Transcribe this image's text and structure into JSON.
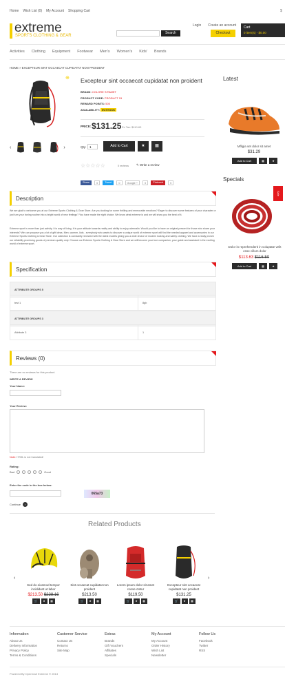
{
  "topnav": {
    "items": [
      "Home",
      "Wish List (0)",
      "My Account",
      "Shopping Cart"
    ],
    "currency": "$"
  },
  "logo": {
    "title": "extreme",
    "subtitle": "SPORTS CLOTHING & GEAR"
  },
  "search": {
    "placeholder": "",
    "button": "Search"
  },
  "account": {
    "login": "Login",
    "create": "Create an account",
    "checkout": "Checkout"
  },
  "cart": {
    "label": "Cart",
    "value": "0 item(s) - $0.00"
  },
  "categories": [
    "Activities",
    "Clothing",
    "Equipment",
    "Footwear",
    "Men's",
    "Women's",
    "Kids'",
    "Brands"
  ],
  "breadcrumb": "HOME » EXCEPTEUR SINT OCCAECAT CUPIDATAT NON PROIDENT",
  "product": {
    "title": "Excepteur sint occaecat cupidatat non proident",
    "brand_label": "BRAND:",
    "brand": "COLORE SITAMET",
    "code_label": "PRODUCT CODE:",
    "code": "PRODUCT 15",
    "points_label": "REWARD POINTS:",
    "points": "500",
    "avail_label": "AVAILABILITY:",
    "avail": "IN STOCK",
    "price_label": "PRICE:",
    "price": "$131.25",
    "extax": "Ex Tax: $110.63",
    "qty_label": "Qty:",
    "qty": "1",
    "add": "Add to Cart",
    "reviews": "0 reviews",
    "write": "Write a review"
  },
  "social": {
    "share": "Share",
    "share_n": "0",
    "tweet": "Tweet",
    "tweet_n": "0",
    "google": "Google +",
    "google_n": "0",
    "pin": "Pinterest",
    "pin_n": "0"
  },
  "description": {
    "title": "Description",
    "p1": "We are glad to welcome you at our Extreme Sports Clothing & Gear Store. Are you looking for some thrilling and memorable emotions? Eager to discover some features of your character or just turn your boring routine into a bright world of new feelings? You have made the right choice. We know what extreme is and we will show you the best of it.",
    "p2": "Extreme sport is more than just activity. It is way of living. It is your attitude towards reality and ability to enjoy adrenalin. Would you like to have an original present for those who share your interests? We can propose you a lot of gift ideas. Men, women, kids - everybody who wants to discover a unique world of extreme sport will find the needed apparel and accessories in our Extreme Sports Clothing & Gear Store. Our collection is constantly renewed with the latest models giving you a wide choice of modern looking and safety clothing. We have a really proven our reliability promising goods of premium quality only. Choose our Extreme Sports Clothing & Gear Store and we will become your true companion, your guide and assistant in the exciting world of extreme sport."
  },
  "spec": {
    "title": "Specification",
    "rows": [
      [
        "ATTRIBUTE GROUPS 5",
        ""
      ],
      [
        "test 1",
        "8gb"
      ],
      [
        "ATTRIBUTE GROUPS 3",
        ""
      ],
      [
        "Attribute 3",
        "1"
      ]
    ]
  },
  "reviews": {
    "title": "Reviews (0)",
    "none": "There are no reviews for this product.",
    "write": "WRITE A REVIEW",
    "name": "Your Name:",
    "review": "Your Review:",
    "note_label": "Note:",
    "note": "HTML is not translated!",
    "rating": "Rating:",
    "bad": "Bad",
    "good": "Good",
    "captcha_label": "Enter the code in the box below:",
    "captcha": "065a73",
    "continue": "Continue"
  },
  "sidebar": {
    "latest": "Latest",
    "latest_name": "Mfligia set dolor sit amet",
    "latest_price": "$31.29",
    "add": "Add to Cart",
    "specials": "Specials",
    "sale": "Sale",
    "special_name": "Dolor in reprehenderit in voluptate velit esse cillum dolor",
    "special_new": "$113.63",
    "special_old": "$116.50"
  },
  "related": {
    "title": "Related Products",
    "items": [
      {
        "name": "Sed do eiusmod tempor incididunt ut labor",
        "new": "$213.50",
        "old": "$228.16",
        "sale": true
      },
      {
        "name": "Sint occaecat cupidatat non proident",
        "new": "$213.50",
        "old": "",
        "sale": false
      },
      {
        "name": "Lorem ipsum dolor sit amet conse ctetur",
        "new": "$119.50",
        "old": "",
        "sale": false
      },
      {
        "name": "Excepteur sint occaecat cupidatat non proident",
        "new": "$131.25",
        "old": "",
        "sale": false
      }
    ]
  },
  "footer": {
    "cols": [
      {
        "h": "Information",
        "items": [
          "About Us",
          "Delivery Information",
          "Privacy Policy",
          "Terms & Conditions"
        ]
      },
      {
        "h": "Customer Service",
        "items": [
          "Contact Us",
          "Returns",
          "Site Map"
        ]
      },
      {
        "h": "Extras",
        "items": [
          "Brands",
          "Gift Vouchers",
          "Affiliates",
          "Specials"
        ]
      },
      {
        "h": "My Account",
        "items": [
          "My Account",
          "Order History",
          "Wish List",
          "Newsletter"
        ]
      },
      {
        "h": "Follow Us",
        "items": [
          "Facebook",
          "Twitter",
          "RSS"
        ]
      }
    ],
    "powered": "Powered By OpenCart Extreme © 2013"
  },
  "colors": {
    "accent": "#f5d000",
    "sale": "#e4181c",
    "dark": "#2b2b2b"
  }
}
